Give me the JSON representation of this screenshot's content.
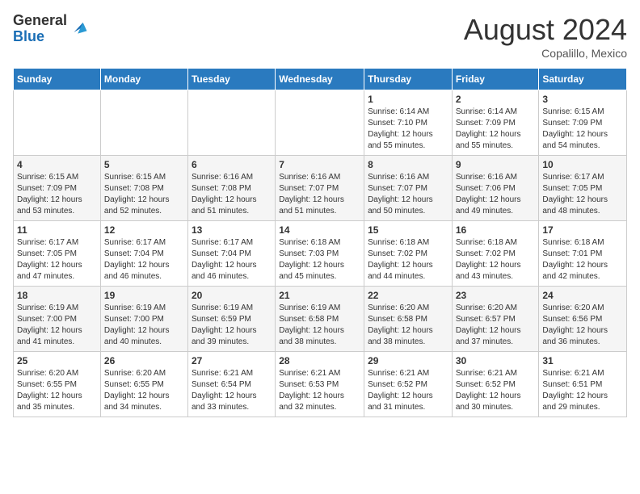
{
  "header": {
    "logo_general": "General",
    "logo_blue": "Blue",
    "month_year": "August 2024",
    "location": "Copalillo, Mexico"
  },
  "weekdays": [
    "Sunday",
    "Monday",
    "Tuesday",
    "Wednesday",
    "Thursday",
    "Friday",
    "Saturday"
  ],
  "weeks": [
    [
      {
        "day": "",
        "info": ""
      },
      {
        "day": "",
        "info": ""
      },
      {
        "day": "",
        "info": ""
      },
      {
        "day": "",
        "info": ""
      },
      {
        "day": "1",
        "info": "Sunrise: 6:14 AM\nSunset: 7:10 PM\nDaylight: 12 hours\nand 55 minutes."
      },
      {
        "day": "2",
        "info": "Sunrise: 6:14 AM\nSunset: 7:09 PM\nDaylight: 12 hours\nand 55 minutes."
      },
      {
        "day": "3",
        "info": "Sunrise: 6:15 AM\nSunset: 7:09 PM\nDaylight: 12 hours\nand 54 minutes."
      }
    ],
    [
      {
        "day": "4",
        "info": "Sunrise: 6:15 AM\nSunset: 7:09 PM\nDaylight: 12 hours\nand 53 minutes."
      },
      {
        "day": "5",
        "info": "Sunrise: 6:15 AM\nSunset: 7:08 PM\nDaylight: 12 hours\nand 52 minutes."
      },
      {
        "day": "6",
        "info": "Sunrise: 6:16 AM\nSunset: 7:08 PM\nDaylight: 12 hours\nand 51 minutes."
      },
      {
        "day": "7",
        "info": "Sunrise: 6:16 AM\nSunset: 7:07 PM\nDaylight: 12 hours\nand 51 minutes."
      },
      {
        "day": "8",
        "info": "Sunrise: 6:16 AM\nSunset: 7:07 PM\nDaylight: 12 hours\nand 50 minutes."
      },
      {
        "day": "9",
        "info": "Sunrise: 6:16 AM\nSunset: 7:06 PM\nDaylight: 12 hours\nand 49 minutes."
      },
      {
        "day": "10",
        "info": "Sunrise: 6:17 AM\nSunset: 7:05 PM\nDaylight: 12 hours\nand 48 minutes."
      }
    ],
    [
      {
        "day": "11",
        "info": "Sunrise: 6:17 AM\nSunset: 7:05 PM\nDaylight: 12 hours\nand 47 minutes."
      },
      {
        "day": "12",
        "info": "Sunrise: 6:17 AM\nSunset: 7:04 PM\nDaylight: 12 hours\nand 46 minutes."
      },
      {
        "day": "13",
        "info": "Sunrise: 6:17 AM\nSunset: 7:04 PM\nDaylight: 12 hours\nand 46 minutes."
      },
      {
        "day": "14",
        "info": "Sunrise: 6:18 AM\nSunset: 7:03 PM\nDaylight: 12 hours\nand 45 minutes."
      },
      {
        "day": "15",
        "info": "Sunrise: 6:18 AM\nSunset: 7:02 PM\nDaylight: 12 hours\nand 44 minutes."
      },
      {
        "day": "16",
        "info": "Sunrise: 6:18 AM\nSunset: 7:02 PM\nDaylight: 12 hours\nand 43 minutes."
      },
      {
        "day": "17",
        "info": "Sunrise: 6:18 AM\nSunset: 7:01 PM\nDaylight: 12 hours\nand 42 minutes."
      }
    ],
    [
      {
        "day": "18",
        "info": "Sunrise: 6:19 AM\nSunset: 7:00 PM\nDaylight: 12 hours\nand 41 minutes."
      },
      {
        "day": "19",
        "info": "Sunrise: 6:19 AM\nSunset: 7:00 PM\nDaylight: 12 hours\nand 40 minutes."
      },
      {
        "day": "20",
        "info": "Sunrise: 6:19 AM\nSunset: 6:59 PM\nDaylight: 12 hours\nand 39 minutes."
      },
      {
        "day": "21",
        "info": "Sunrise: 6:19 AM\nSunset: 6:58 PM\nDaylight: 12 hours\nand 38 minutes."
      },
      {
        "day": "22",
        "info": "Sunrise: 6:20 AM\nSunset: 6:58 PM\nDaylight: 12 hours\nand 38 minutes."
      },
      {
        "day": "23",
        "info": "Sunrise: 6:20 AM\nSunset: 6:57 PM\nDaylight: 12 hours\nand 37 minutes."
      },
      {
        "day": "24",
        "info": "Sunrise: 6:20 AM\nSunset: 6:56 PM\nDaylight: 12 hours\nand 36 minutes."
      }
    ],
    [
      {
        "day": "25",
        "info": "Sunrise: 6:20 AM\nSunset: 6:55 PM\nDaylight: 12 hours\nand 35 minutes."
      },
      {
        "day": "26",
        "info": "Sunrise: 6:20 AM\nSunset: 6:55 PM\nDaylight: 12 hours\nand 34 minutes."
      },
      {
        "day": "27",
        "info": "Sunrise: 6:21 AM\nSunset: 6:54 PM\nDaylight: 12 hours\nand 33 minutes."
      },
      {
        "day": "28",
        "info": "Sunrise: 6:21 AM\nSunset: 6:53 PM\nDaylight: 12 hours\nand 32 minutes."
      },
      {
        "day": "29",
        "info": "Sunrise: 6:21 AM\nSunset: 6:52 PM\nDaylight: 12 hours\nand 31 minutes."
      },
      {
        "day": "30",
        "info": "Sunrise: 6:21 AM\nSunset: 6:52 PM\nDaylight: 12 hours\nand 30 minutes."
      },
      {
        "day": "31",
        "info": "Sunrise: 6:21 AM\nSunset: 6:51 PM\nDaylight: 12 hours\nand 29 minutes."
      }
    ]
  ]
}
